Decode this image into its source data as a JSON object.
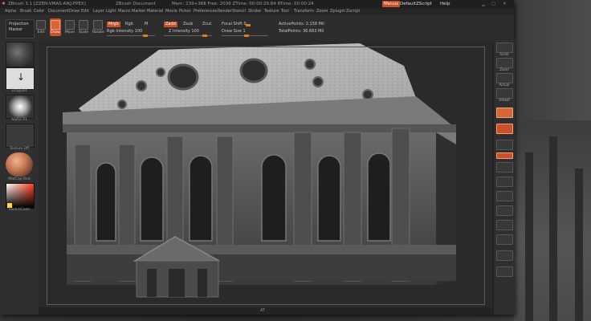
{
  "window": {
    "title": "ZBrush 3.1 [ZZEN-VMAS-AIKJ-FPEX]",
    "document": "ZBrush Document",
    "mem": "Mem: 239+368  Free: 2036  ZTime: 00:00:29.84  RTime: 00:00:24",
    "menus_button": "Menus",
    "script": "DefaultZScript",
    "help": "Help"
  },
  "menubar": [
    "Alpha",
    "Brush",
    "Color",
    "Document",
    "Draw",
    "Edit",
    "Layer",
    "Light",
    "Macro",
    "Marker",
    "Material",
    "Movie",
    "Picker",
    "Preferences",
    "Render",
    "Stencil",
    "Stroke",
    "Texture",
    "Tool",
    "Transform",
    "Zoom",
    "Zplugin",
    "Zscript"
  ],
  "shelf": {
    "projection_master": [
      "Projection",
      "Master"
    ],
    "tools": [
      {
        "icon": "edit-icon",
        "label": "Edit"
      },
      {
        "icon": "draw-icon",
        "label": "Draw"
      },
      {
        "icon": "move-icon",
        "label": "Move"
      },
      {
        "icon": "scale-icon",
        "label": "Scale"
      },
      {
        "icon": "rotate-icon",
        "label": "Rotate"
      }
    ],
    "mrgb": "Mrgb",
    "rgb": "Rgb",
    "m": "M",
    "rgb_intensity": "Rgb Intensity 100",
    "zadd": "Zadd",
    "zsub": "Zsub",
    "zcut": "Zcut",
    "z_intensity": "Z Intensity 100",
    "focal_shift": "Focal Shift 0",
    "draw_size": "Draw Size 1",
    "active_points": "ActivePoints: 2.158 Mil",
    "total_points": "TotalPoints: 36.663 Mil"
  },
  "left_tray": {
    "brush_label": "",
    "stroke_label": "DragDot",
    "alpha_label": "Alpha 01",
    "texture_label": "Texture Off",
    "material_label": "MatCap Red",
    "color_label": "SwitchColor",
    "material_color": "#c87a5a"
  },
  "right_tray": [
    {
      "label": "Scroll"
    },
    {
      "label": "Zoom"
    },
    {
      "label": "Actual"
    },
    {
      "label": "AAHalf"
    },
    {
      "label": ""
    },
    {
      "label": ""
    },
    {
      "label": ""
    },
    {
      "label": ""
    },
    {
      "label": ""
    },
    {
      "label": ""
    },
    {
      "label": ""
    },
    {
      "label": ""
    },
    {
      "label": ""
    },
    {
      "label": ""
    },
    {
      "label": ""
    },
    {
      "label": ""
    },
    {
      "label": ""
    },
    {
      "label": ""
    },
    {
      "label": ""
    },
    {
      "label": ""
    }
  ],
  "bottom": {
    "label": "AT"
  },
  "colors": {
    "accent": "#e07a1f",
    "highlight": "#d9452b"
  }
}
